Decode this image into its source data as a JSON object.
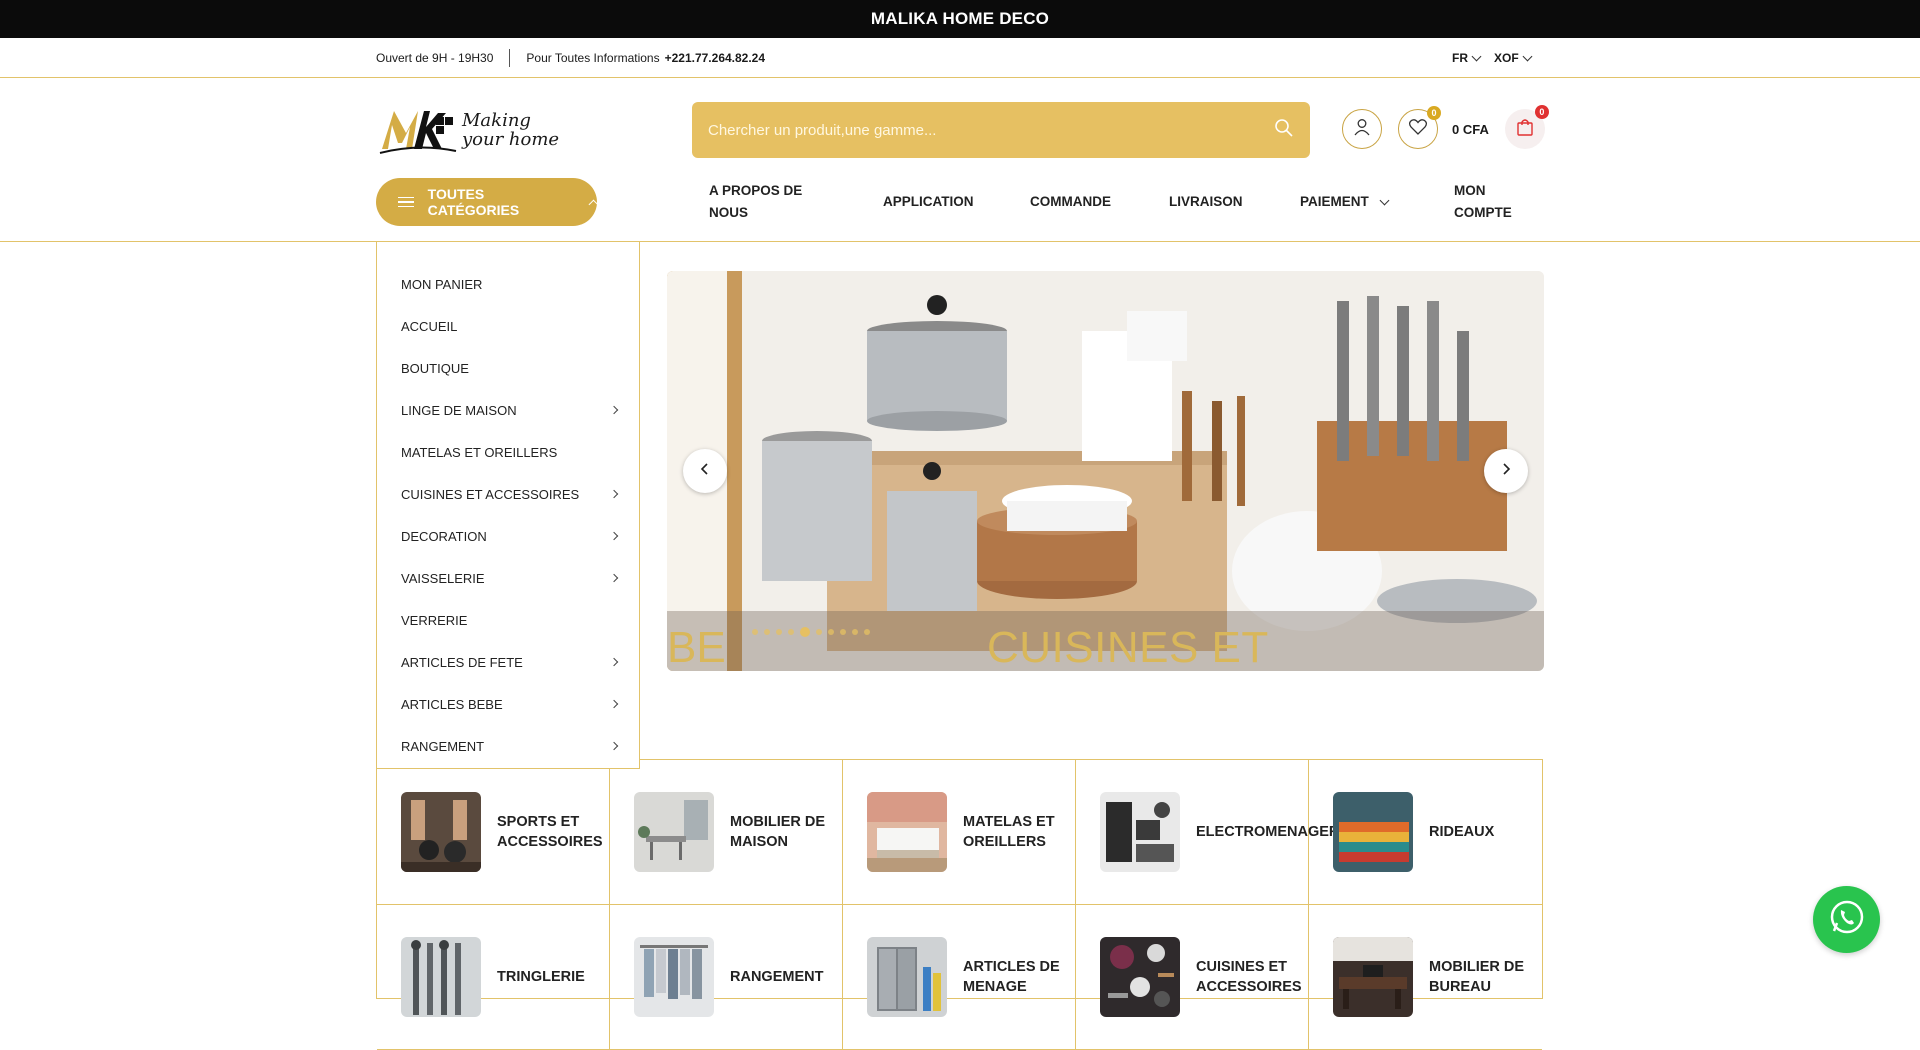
{
  "announcement": "MALIKA HOME DECO",
  "infobar": {
    "hours": "Ouvert de 9H - 19H30",
    "contact_label": "Pour Toutes Informations",
    "phone": "+221.77.264.82.24",
    "language": "FR",
    "currency": "XOF"
  },
  "logo": {
    "line1": "Making",
    "line2": "your home"
  },
  "search": {
    "placeholder": "Chercher un produit,une gamme..."
  },
  "header": {
    "wishlist_count": "0",
    "cart_amount": "0 CFA",
    "cart_count": "0"
  },
  "category_button": "TOUTES CATÉGORIES",
  "nav": {
    "about": "A PROPOS DE NOUS",
    "app": "APPLICATION",
    "order": "COMMANDE",
    "delivery": "LIVRAISON",
    "payment": "PAIEMENT",
    "account": "MON COMPTE"
  },
  "sidebar": [
    {
      "label": "MON PANIER ",
      "sub": false
    },
    {
      "label": "ACCUEIL",
      "sub": false
    },
    {
      "label": "BOUTIQUE",
      "sub": false
    },
    {
      "label": "LINGE DE MAISON",
      "sub": true
    },
    {
      "label": "MATELAS ET OREILLERS",
      "sub": false
    },
    {
      "label": "CUISINES ET ACCESSOIRES",
      "sub": true
    },
    {
      "label": "DECORATION",
      "sub": true
    },
    {
      "label": "VAISSELERIE",
      "sub": true
    },
    {
      "label": "VERRERIE",
      "sub": false
    },
    {
      "label": "ARTICLES DE FETE",
      "sub": true
    },
    {
      "label": "ARTICLES BEBE",
      "sub": true
    },
    {
      "label": "RANGEMENT",
      "sub": true
    }
  ],
  "slider": {
    "caption": "CUISINES ET ACCESSOIRES",
    "caption_prev": "BE",
    "dot_count": 10,
    "active_dot": 4
  },
  "categories": [
    {
      "title": "SPORTS ET ACCESSOIRES",
      "thumb": "sports"
    },
    {
      "title": "MOBILIER DE MAISON",
      "thumb": "furniture"
    },
    {
      "title": "MATELAS ET OREILLERS",
      "thumb": "mattress"
    },
    {
      "title": "ELECTROMENAGER",
      "thumb": "appliances"
    },
    {
      "title": "RIDEAUX",
      "thumb": "curtains"
    },
    {
      "title": "TRINGLERIE",
      "thumb": "rods"
    },
    {
      "title": "RANGEMENT",
      "thumb": "storage"
    },
    {
      "title": "ARTICLES DE MENAGE",
      "thumb": "household"
    },
    {
      "title": "CUISINES ET ACCESSOIRES",
      "thumb": "kitchen"
    },
    {
      "title": "MOBILIER DE BUREAU",
      "thumb": "office"
    }
  ],
  "colors": {
    "gold": "#d4ac45",
    "gold_light": "#e6c062",
    "black": "#0b0b0b",
    "whatsapp": "#29c44e"
  }
}
